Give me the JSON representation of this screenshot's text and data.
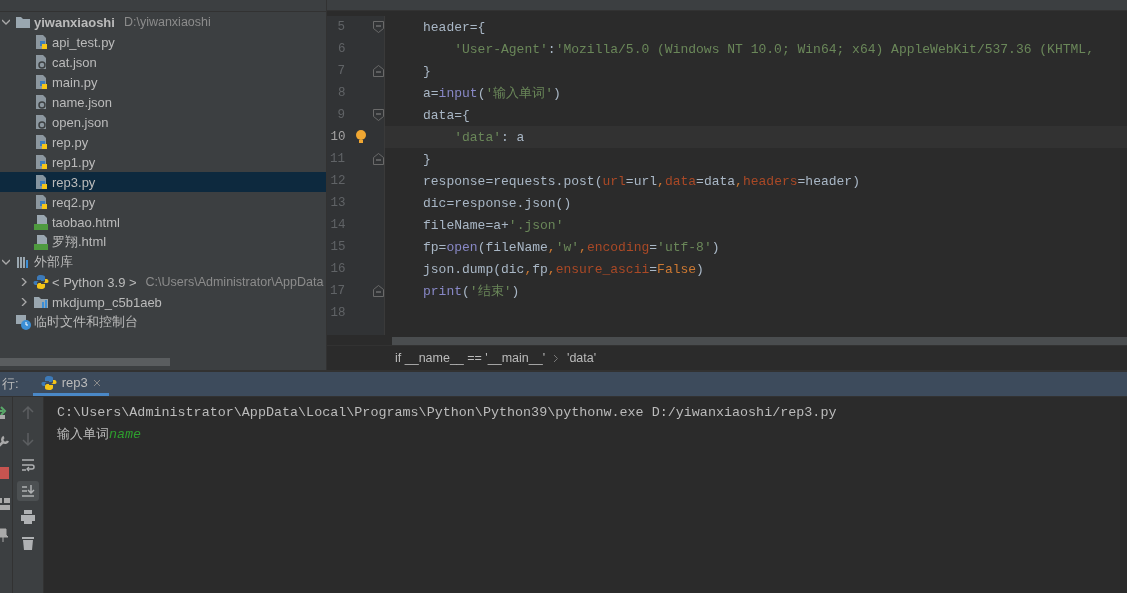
{
  "project_tree": [
    {
      "label": "yiwanxiaoshi",
      "path": "D:\\yiwanxiaoshi",
      "kind": "folder",
      "expanded": true,
      "selected": false,
      "children": [
        {
          "label": "api_test.py",
          "kind": "py",
          "selected": false
        },
        {
          "label": "cat.json",
          "kind": "json",
          "selected": false
        },
        {
          "label": "main.py",
          "kind": "py",
          "selected": false
        },
        {
          "label": "name.json",
          "kind": "json",
          "selected": false
        },
        {
          "label": "open.json",
          "kind": "json",
          "selected": false
        },
        {
          "label": "rep.py",
          "kind": "py",
          "selected": false
        },
        {
          "label": "rep1.py",
          "kind": "py",
          "selected": false
        },
        {
          "label": "rep3.py",
          "kind": "py",
          "selected": true
        },
        {
          "label": "req2.py",
          "kind": "py",
          "selected": false
        },
        {
          "label": "taobao.html",
          "kind": "html",
          "selected": false
        },
        {
          "label": "罗翔.html",
          "kind": "html",
          "selected": false
        }
      ]
    },
    {
      "label": "外部库",
      "kind": "library",
      "expanded": true,
      "selected": false,
      "children": [
        {
          "label": "< Python 3.9 >",
          "path": "C:\\Users\\Administrator\\AppData",
          "kind": "python",
          "expanded": false,
          "selected": false
        },
        {
          "label": "mkdjump_c5b1aeb",
          "kind": "package",
          "expanded": false,
          "selected": false
        }
      ]
    },
    {
      "label": "临时文件和控制台",
      "kind": "scratch",
      "selected": false
    }
  ],
  "editor": {
    "lines": [
      {
        "number": "5",
        "kind": "fold-start",
        "current": false,
        "tokens": [
          {
            "text": "header={",
            "kind": "plain"
          }
        ]
      },
      {
        "number": "6",
        "kind": "plain",
        "current": false,
        "tokens": [
          {
            "text": "    'User-Agent'",
            "kind": "string"
          },
          {
            "text": ":",
            "kind": "plain"
          },
          {
            "text": "'Mozilla/5.0 (Windows NT 10.0; Win64; x64) AppleWebKit/537.36 (KHTML,",
            "kind": "string"
          }
        ]
      },
      {
        "number": "7",
        "kind": "fold-end",
        "current": false,
        "tokens": [
          {
            "text": "}",
            "kind": "plain"
          }
        ]
      },
      {
        "number": "8",
        "kind": "plain",
        "current": false,
        "tokens": [
          {
            "text": "a=",
            "kind": "plain"
          },
          {
            "text": "input",
            "kind": "builtin"
          },
          {
            "text": "(",
            "kind": "plain"
          },
          {
            "text": "'输入单词'",
            "kind": "string"
          },
          {
            "text": ")",
            "kind": "plain"
          }
        ]
      },
      {
        "number": "9",
        "kind": "fold-start",
        "current": false,
        "tokens": [
          {
            "text": "data={",
            "kind": "plain"
          }
        ]
      },
      {
        "number": "10",
        "kind": "plain",
        "current": true,
        "tokens": [
          {
            "text": "    'data'",
            "kind": "string"
          },
          {
            "text": ": a",
            "kind": "plain"
          }
        ]
      },
      {
        "number": "11",
        "kind": "fold-end",
        "current": false,
        "tokens": [
          {
            "text": "}",
            "kind": "plain"
          }
        ]
      },
      {
        "number": "12",
        "kind": "plain",
        "current": false,
        "tokens": [
          {
            "text": "response=requests.post(",
            "kind": "plain"
          },
          {
            "text": "url",
            "kind": "param"
          },
          {
            "text": "=url",
            "kind": "plain"
          },
          {
            "text": ",",
            "kind": "punct"
          },
          {
            "text": "data",
            "kind": "param"
          },
          {
            "text": "=data",
            "kind": "plain"
          },
          {
            "text": ",",
            "kind": "punct"
          },
          {
            "text": "headers",
            "kind": "param"
          },
          {
            "text": "=header)",
            "kind": "plain"
          }
        ]
      },
      {
        "number": "13",
        "kind": "plain",
        "current": false,
        "tokens": [
          {
            "text": "dic=response.json()",
            "kind": "plain"
          }
        ]
      },
      {
        "number": "14",
        "kind": "plain",
        "current": false,
        "tokens": [
          {
            "text": "fileName=a+",
            "kind": "plain"
          },
          {
            "text": "'.json'",
            "kind": "string"
          }
        ]
      },
      {
        "number": "15",
        "kind": "plain",
        "current": false,
        "tokens": [
          {
            "text": "fp=",
            "kind": "plain"
          },
          {
            "text": "open",
            "kind": "builtin"
          },
          {
            "text": "(fileName",
            "kind": "plain"
          },
          {
            "text": ",",
            "kind": "punct"
          },
          {
            "text": "'w'",
            "kind": "string"
          },
          {
            "text": ",",
            "kind": "punct"
          },
          {
            "text": "encoding",
            "kind": "param"
          },
          {
            "text": "=",
            "kind": "plain"
          },
          {
            "text": "'utf-8'",
            "kind": "string"
          },
          {
            "text": ")",
            "kind": "plain"
          }
        ]
      },
      {
        "number": "16",
        "kind": "plain",
        "current": false,
        "tokens": [
          {
            "text": "json.dump(dic",
            "kind": "plain"
          },
          {
            "text": ",",
            "kind": "punct"
          },
          {
            "text": "fp",
            "kind": "plain"
          },
          {
            "text": ",",
            "kind": "punct"
          },
          {
            "text": "ensure_ascii",
            "kind": "param"
          },
          {
            "text": "=",
            "kind": "plain"
          },
          {
            "text": "False",
            "kind": "keyword"
          },
          {
            "text": ")",
            "kind": "plain"
          }
        ]
      },
      {
        "number": "17",
        "kind": "fold-end",
        "current": false,
        "tokens": [
          {
            "text": "print",
            "kind": "builtin"
          },
          {
            "text": "(",
            "kind": "plain"
          },
          {
            "text": "'结束'",
            "kind": "string"
          },
          {
            "text": ")",
            "kind": "plain"
          }
        ]
      },
      {
        "number": "18",
        "kind": "plain",
        "current": false
      }
    ],
    "breadcrumbs": [
      "if __name__ == '__main__'",
      "'data'"
    ]
  },
  "run": {
    "label": "行:",
    "tabs": [
      {
        "label": "rep3",
        "selected": true
      }
    ],
    "side_tools": [
      {
        "kind": "rerun"
      },
      {
        "kind": "wrench"
      },
      {
        "kind": "stop"
      },
      {
        "kind": "layout"
      },
      {
        "kind": "pin"
      }
    ],
    "tools": [
      {
        "kind": "up",
        "disabled": true
      },
      {
        "kind": "down",
        "disabled": true
      },
      {
        "kind": "wrap",
        "on": false
      },
      {
        "kind": "scroll-end",
        "on": true
      },
      {
        "kind": "print"
      },
      {
        "kind": "trash"
      }
    ],
    "output": [
      {
        "segments": [
          {
            "text": "C:\\Users\\Administrator\\AppData\\Local\\Programs\\Python\\Python39\\pythonw.exe D:/yiwanxiaoshi/rep3.py",
            "kind": "output"
          }
        ]
      },
      {
        "segments": [
          {
            "text": "输入单词",
            "kind": "output"
          },
          {
            "text": "name",
            "kind": "input"
          }
        ]
      }
    ]
  }
}
